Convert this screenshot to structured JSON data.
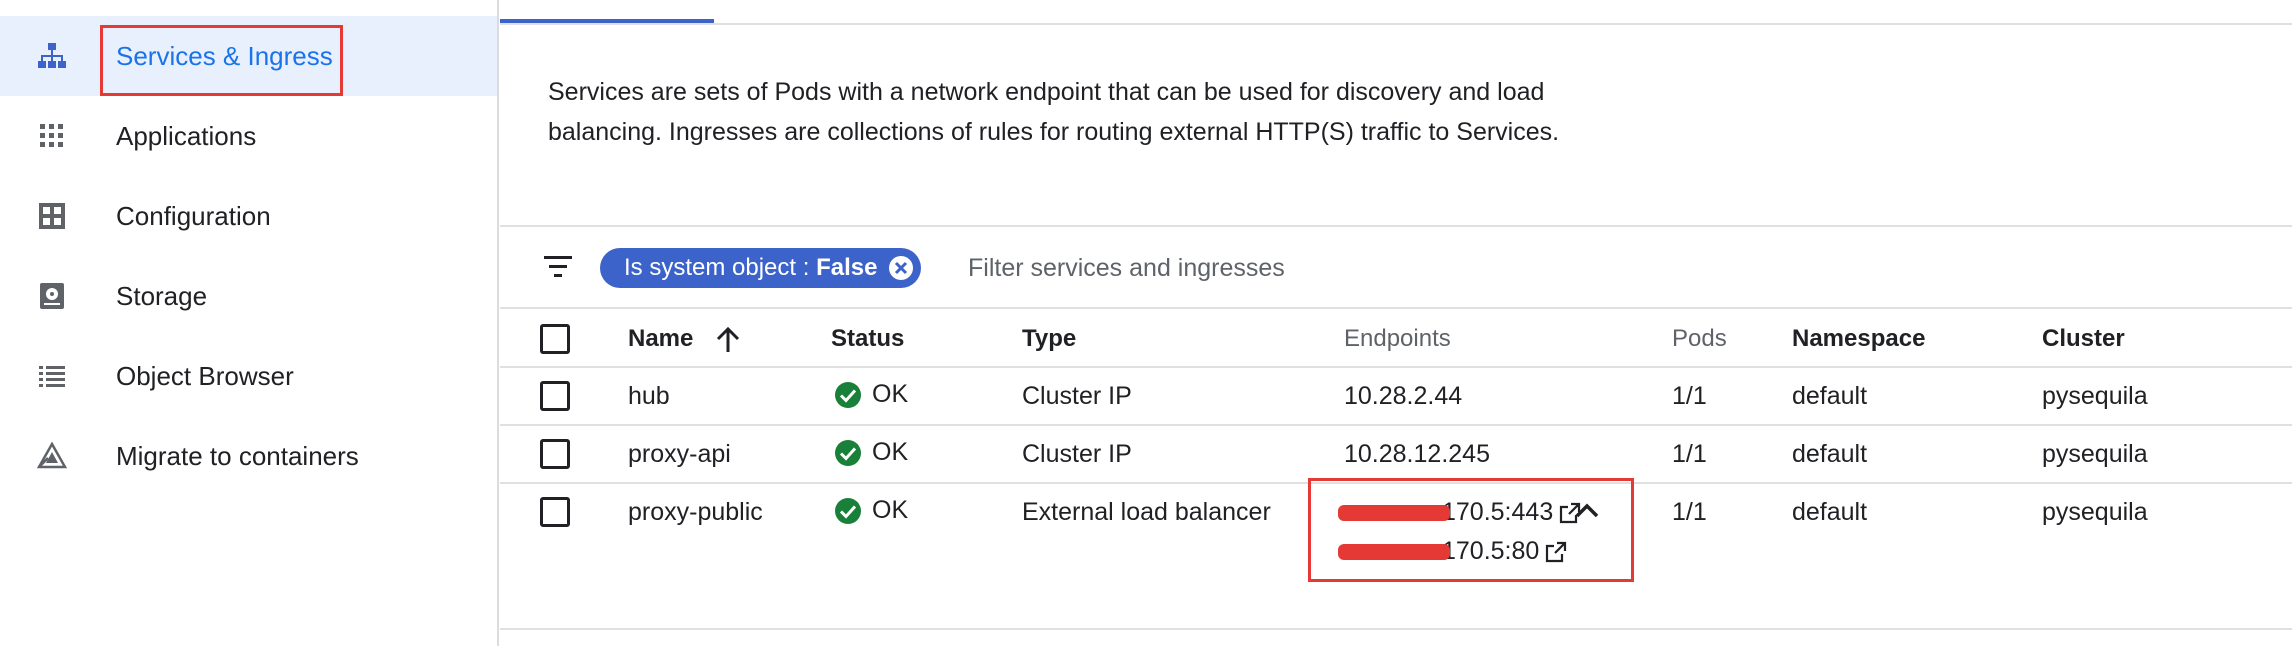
{
  "sidebar": {
    "items": [
      {
        "label": "Services & Ingress",
        "icon": "services-ingress-icon",
        "active": true
      },
      {
        "label": "Applications",
        "icon": "apps-grid-icon",
        "active": false
      },
      {
        "label": "Configuration",
        "icon": "configuration-icon",
        "active": false
      },
      {
        "label": "Storage",
        "icon": "storage-icon",
        "active": false
      },
      {
        "label": "Object Browser",
        "icon": "list-icon",
        "active": false
      },
      {
        "label": "Migrate to containers",
        "icon": "migrate-icon",
        "active": false
      }
    ]
  },
  "main": {
    "description": "Services are sets of Pods with a network endpoint that can be used for discovery and load balancing. Ingresses are collections of rules for routing external HTTP(S) traffic to Services.",
    "filter": {
      "chip_key": "Is system object : ",
      "chip_value": "False",
      "placeholder": "Filter services and ingresses"
    },
    "table": {
      "headers": {
        "name": "Name",
        "status": "Status",
        "type": "Type",
        "endpoints": "Endpoints",
        "pods": "Pods",
        "namespace": "Namespace",
        "cluster": "Cluster"
      },
      "rows": [
        {
          "name": "hub",
          "status": "OK",
          "type": "Cluster IP",
          "endpoint": "10.28.2.44",
          "pods": "1/1",
          "namespace": "default",
          "cluster": "pysequila"
        },
        {
          "name": "proxy-api",
          "status": "OK",
          "type": "Cluster IP",
          "endpoint": "10.28.12.245",
          "pods": "1/1",
          "namespace": "default",
          "cluster": "pysequila"
        },
        {
          "name": "proxy-public",
          "status": "OK",
          "type": "External load balancer",
          "endpoint_1": "170.5:443",
          "endpoint_2": "170.5:80",
          "pods": "1/1",
          "namespace": "default",
          "cluster": "pysequila"
        }
      ]
    }
  },
  "colors": {
    "accent": "#3c63c9",
    "active_bg": "#e8f0fe",
    "ok_green": "#188038",
    "annotation_red": "#e53935"
  }
}
